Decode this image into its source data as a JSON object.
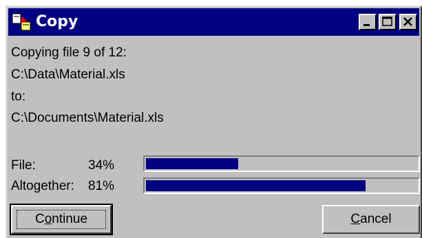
{
  "window": {
    "title": "Copy",
    "title_bar_color": "#000080",
    "face_color": "#c0c0c0",
    "controls": [
      "minimize-icon",
      "maximize-icon",
      "close-icon"
    ]
  },
  "status": {
    "copying_line": "Copying file 9 of 12:",
    "source_path": "C:\\Data\\Material.xls",
    "to_label": "to:",
    "dest_path": "C:\\Documents\\Material.xls"
  },
  "progress": {
    "file_label": "File:",
    "file_percent_text": "34%",
    "file_fraction": 0.34,
    "total_label": "Altogether:",
    "total_percent_text": "81%",
    "total_fraction": 0.81,
    "bar_color": "#000080"
  },
  "buttons": {
    "continue_label": "Continue",
    "continue_pre": "C",
    "continue_mnemonic": "o",
    "continue_post": "ntinue",
    "cancel_label": "Cancel",
    "cancel_mnemonic": "C",
    "cancel_post": "ancel"
  }
}
